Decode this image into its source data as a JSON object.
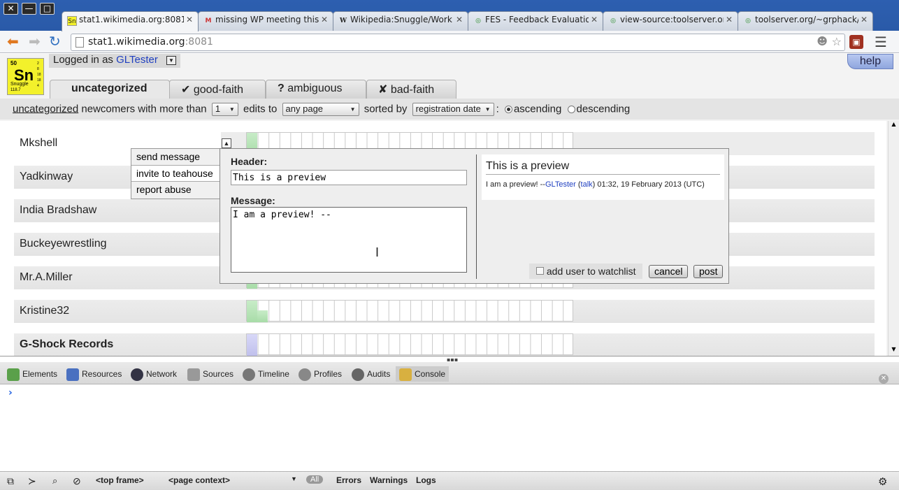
{
  "window": {
    "close_label": "✕",
    "min_label": "—",
    "max_label": "□"
  },
  "browser_tabs": [
    {
      "title": "stat1.wikimedia.org:8081",
      "favicon": "Sn",
      "active": true
    },
    {
      "title": "missing WP meeting this w",
      "favicon": "M"
    },
    {
      "title": "Wikipedia:Snuggle/Work l",
      "favicon": "W"
    },
    {
      "title": "FES - Feedback Evaluation",
      "favicon": "◎"
    },
    {
      "title": "view-source:toolserver.or",
      "favicon": "◎"
    },
    {
      "title": "toolserver.org/~grphack/",
      "favicon": "◎"
    }
  ],
  "omnibox": {
    "host": "stat1.wikimedia.org",
    "port": ":8081"
  },
  "snuggle": {
    "logo": {
      "number": "50",
      "symbol": "Sn",
      "name": "Snuggle",
      "mass": "118.7",
      "side": "2 8 18 18 4"
    },
    "login": {
      "prefix": "Logged in as ",
      "user": "GLTester"
    },
    "help_label": "help",
    "category_tabs": [
      {
        "label": "uncategorized",
        "icon": ""
      },
      {
        "label": "good-faith",
        "icon": "✔"
      },
      {
        "label": "ambiguous",
        "icon": "?"
      },
      {
        "label": "bad-faith",
        "icon": "✘"
      }
    ],
    "filter": {
      "category": "uncategorized",
      "t1": "newcomers with more than",
      "edits": "1",
      "t2": "edits to",
      "namespace": "any page",
      "t3": "sorted by",
      "sort": "registration date",
      "colon": ":",
      "asc": "ascending",
      "desc": "descending"
    },
    "users": [
      "Mkshell",
      "Yadkinway",
      "India Bradshaw",
      "Buckeyewrestling",
      "Mr.A.Miller",
      "Kristine32",
      "G-Shock Records"
    ],
    "action_menu": [
      "send message",
      "invite to teahouse",
      "report abuse"
    ],
    "dialog": {
      "header_label": "Header:",
      "header_value": "This is a preview",
      "message_label": "Message:",
      "message_value": "I am a preview! --",
      "preview_title": "This is a preview",
      "preview_text": "I am a preview! --",
      "preview_user": "GLTester",
      "preview_talk": "talk",
      "preview_time": "01:32, 19 February 2013 (UTC)",
      "watchlist_label": "add user to watchlist",
      "cancel_label": "cancel",
      "post_label": "post"
    }
  },
  "devtools": {
    "tabs": [
      "Elements",
      "Resources",
      "Network",
      "Sources",
      "Timeline",
      "Profiles",
      "Audits",
      "Console"
    ],
    "prompt": "›",
    "frame": "<top frame>",
    "context": "<page context>",
    "filters": [
      "All",
      "Errors",
      "Warnings",
      "Logs"
    ]
  },
  "colors": {
    "accent": "#2040c0",
    "titlebar": "#2d5fb0",
    "logo": "#f3f12b"
  }
}
